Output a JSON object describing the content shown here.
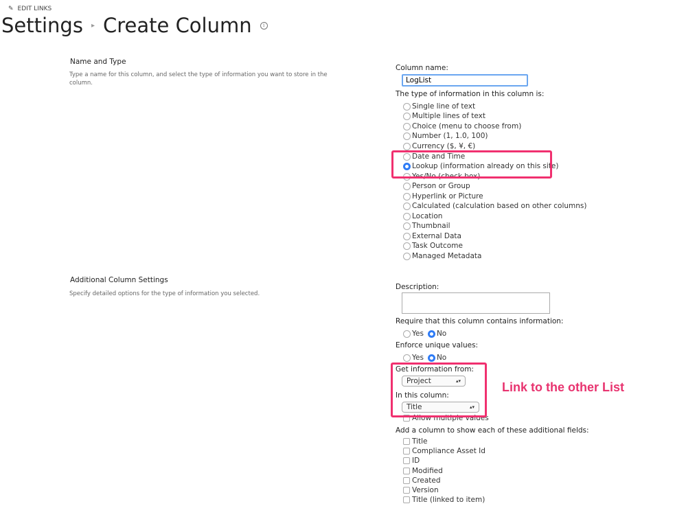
{
  "header": {
    "edit_links": "EDIT LINKS",
    "breadcrumb_parent": "Settings",
    "page_title": "Create Column"
  },
  "name_type": {
    "heading": "Name and Type",
    "description": "Type a name for this column, and select the type of information you want to store in the column.",
    "column_name_label": "Column name:",
    "column_name_value": "LogList",
    "type_label": "The type of information in this column is:",
    "types": [
      "Single line of text",
      "Multiple lines of text",
      "Choice (menu to choose from)",
      "Number (1, 1.0, 100)",
      "Currency ($, ¥, €)",
      "Date and Time",
      "Lookup (information already on this site)",
      "Yes/No (check box)",
      "Person or Group",
      "Hyperlink or Picture",
      "Calculated (calculation based on other columns)",
      "Location",
      "Thumbnail",
      "External Data",
      "Task Outcome",
      "Managed Metadata"
    ],
    "selected_type": "Lookup (information already on this site)"
  },
  "additional": {
    "heading": "Additional Column Settings",
    "description": "Specify detailed options for the type of information you selected.",
    "description_label": "Description:",
    "require_label": "Require that this column contains information:",
    "yes": "Yes",
    "no": "No",
    "unique_label": "Enforce unique values:",
    "get_from_label": "Get information from:",
    "get_from_value": "Project",
    "in_column_label": "In this column:",
    "in_column_value": "Title",
    "allow_multiple": "Allow multiple values",
    "add_fields_label": "Add a column to show each of these additional fields:",
    "fields": [
      "Title",
      "Compliance Asset Id",
      "ID",
      "Modified",
      "Created",
      "Version",
      "Title (linked to item)"
    ]
  },
  "annotation": {
    "text": "Link to the other List",
    "color": "#e8336f"
  }
}
